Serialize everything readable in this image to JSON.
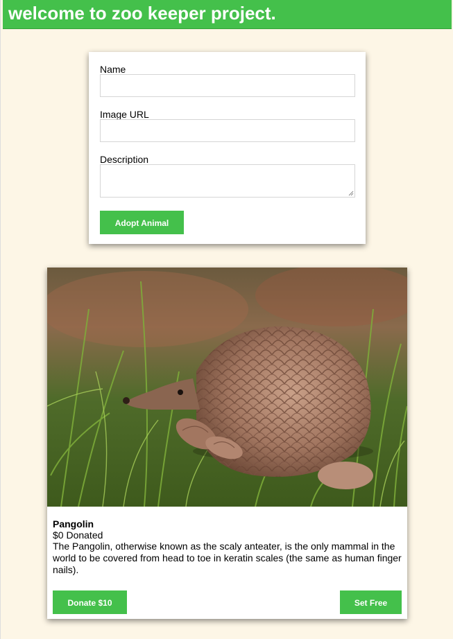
{
  "header": {
    "title": "welcome to zoo keeper project."
  },
  "form": {
    "name_label": "Name",
    "name_value": "",
    "image_url_label": "Image URL",
    "image_url_value": "",
    "description_label": "Description",
    "description_value": "",
    "submit_label": "Adopt Animal"
  },
  "animals": [
    {
      "name": "Pangolin",
      "donated": "$0 Donated",
      "description": "The Pangolin, otherwise known as the scaly anteater, is the only mammal in the world to be covered from head to toe in keratin scales (the same as human finger nails).",
      "donate_label": "Donate $10",
      "free_label": "Set Free"
    }
  ],
  "colors": {
    "accent": "#44c04b",
    "background": "#fdf6e6"
  }
}
